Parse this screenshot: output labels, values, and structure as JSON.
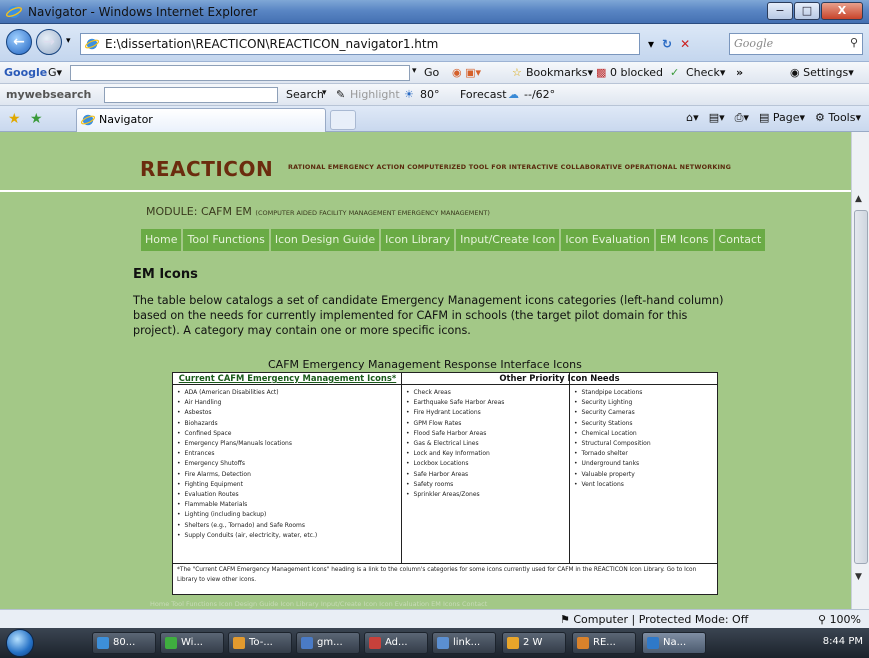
{
  "window": {
    "title": "Navigator - Windows Internet Explorer",
    "min": "−",
    "max": "□",
    "close": "X"
  },
  "address": {
    "url": "E:\\dissertation\\REACTICON\\REACTICON_navigator1.htm",
    "search_placeholder": "Google"
  },
  "google_toolbar": {
    "logo": "Google",
    "go": "Go",
    "bookmarks": "Bookmarks",
    "blocked": "0 blocked",
    "check": "Check",
    "settings": "Settings"
  },
  "mws_toolbar": {
    "logo": "mywebsearch",
    "search": "Search",
    "highlight": "Highlight",
    "temp": "80°",
    "forecast": "Forecast",
    "forecast_val": "--/62°"
  },
  "tab": {
    "label": "Navigator"
  },
  "commands": {
    "page": "Page",
    "tools": "Tools"
  },
  "page": {
    "brand": "REACTICON",
    "brand_sub": "RATIONAL EMERGENCY ACTION COMPUTERIZED TOOL FOR INTERACTIVE COLLABORATIVE OPERATIONAL NETWORKING",
    "module_label": "MODULE: CAFM EM",
    "module_sub": "(COMPUTER AIDED FACILITY MANAGEMENT EMERGENCY MANAGEMENT)",
    "nav": [
      "Home",
      "Tool Functions",
      "Icon Design Guide",
      "Icon Library",
      "Input/Create Icon",
      "Icon Evaluation",
      "EM Icons",
      "Contact"
    ],
    "heading": "EM Icons",
    "intro": "The table below catalogs a set of candidate Emergency Management icons categories (left-hand column) based on the needs for currently implemented for CAFM in schools (the target pilot domain for this project).  A category may contain one or more specific icons.",
    "table_caption": "CAFM Emergency Management Response Interface Icons",
    "col1_header": "Current CAFM Emergency Management Icons*",
    "col2_header": "Other Priority Icon Needs",
    "col1": [
      "ADA (American Disabilities Act)",
      "Air Handling",
      "Asbestos",
      "Biohazards",
      "Confined Space",
      "Emergency Plans/Manuals locations",
      "Entrances",
      "Emergency Shutoffs",
      "Fire Alarms, Detection",
      "Fighting Equipment",
      "Evaluation Routes",
      "Flammable Materials",
      "Lighting (including backup)",
      "Shelters (e.g., Tornado) and Safe Rooms",
      "Supply Conduits (air, electricity, water, etc.)"
    ],
    "col2": [
      "Check Areas",
      "Earthquake Safe Harbor Areas",
      "Fire Hydrant Locations",
      "GPM Flow Rates",
      "Flood Safe Harbor Areas",
      "Gas & Electrical Lines",
      "Lock and Key Information",
      "Lockbox Locations",
      "Safe Harbor Areas",
      "Safety rooms",
      "Sprinkler Areas/Zones"
    ],
    "col3": [
      "Standpipe Locations",
      "Security Lighting",
      "Security Cameras",
      "Security Stations",
      "Chemical Location",
      "Structural Composition",
      "Tornado shelter",
      "Underground tanks",
      "Valuable property",
      "Vent locations"
    ],
    "footnote": "*The \"Current CAFM Emergency Management Icons\" heading is a link to the column's categories for some icons currently used for CAFM in the REACTICON Icon Library.  Go to Icon Library to view other icons.",
    "ghost_nav": "Home   Tool Functions   Icon Design Guide   Icon Library   Input/Create Icon   Icon Evaluation   EM Icons   Contact"
  },
  "status": {
    "zone": "Computer | Protected Mode: Off",
    "zoom": "100%"
  },
  "taskbar": {
    "items": [
      {
        "label": "80...",
        "color": "#3d8fd9"
      },
      {
        "label": "Wi...",
        "color": "#3fae3f"
      },
      {
        "label": "To-...",
        "color": "#e29a2e"
      },
      {
        "label": "gm...",
        "color": "#4a7bc6"
      },
      {
        "label": "Ad...",
        "color": "#c8413b"
      },
      {
        "label": "link...",
        "color": "#5b8fd1"
      },
      {
        "label": "2 W",
        "color": "#e8a52a"
      },
      {
        "label": "RE...",
        "color": "#d9822b"
      },
      {
        "label": "Na...",
        "color": "#2f79c9"
      }
    ],
    "clock": "8:44 PM"
  }
}
